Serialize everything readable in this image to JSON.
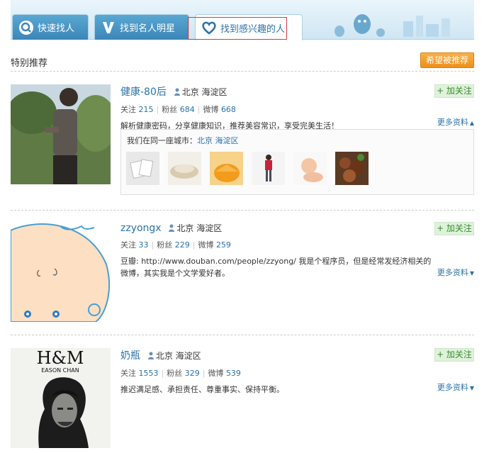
{
  "tabs": [
    {
      "label": "快速找人",
      "icon": "search-icon"
    },
    {
      "label": "找到名人明星",
      "icon": "v-verified-icon"
    },
    {
      "label": "找到感兴趣的人",
      "icon": "heart-icon"
    }
  ],
  "section_title": "特别推荐",
  "hope_button": "希望被推荐",
  "follow_label": "+ 加关注",
  "more_open": "更多资料",
  "more_closed": "更多资料",
  "stat_labels": {
    "follow": "关注",
    "fans": "粉丝",
    "weibo": "微博"
  },
  "users": [
    {
      "name": "健康-80后",
      "location": "北京 海淀区",
      "follow": "215",
      "fans": "684",
      "weibo": "668",
      "desc": "解析健康密码，分享健康知识，推荐美容常识，享受完美生活！",
      "expanded": true
    },
    {
      "name": "zzyongx",
      "location": "北京 海淀区",
      "follow": "33",
      "fans": "229",
      "weibo": "259",
      "desc": "豆瓣: http://www.douban.com/people/zzyong/ 我是个程序员，但是经常发经济相关的微博，其实我是个文学爱好者。",
      "expanded": false
    },
    {
      "name": "奶瓶",
      "location": "北京 海淀区",
      "follow": "1553",
      "fans": "329",
      "weibo": "539",
      "desc": "推迟满足感、承担责任、尊重事实、保持平衡。",
      "expanded": false,
      "avatar_text": "H&M",
      "avatar_subtext": "EASON CHAN"
    }
  ],
  "same_city": {
    "prefix": "我们在同一座城市：",
    "city": "北京 海淀区"
  }
}
